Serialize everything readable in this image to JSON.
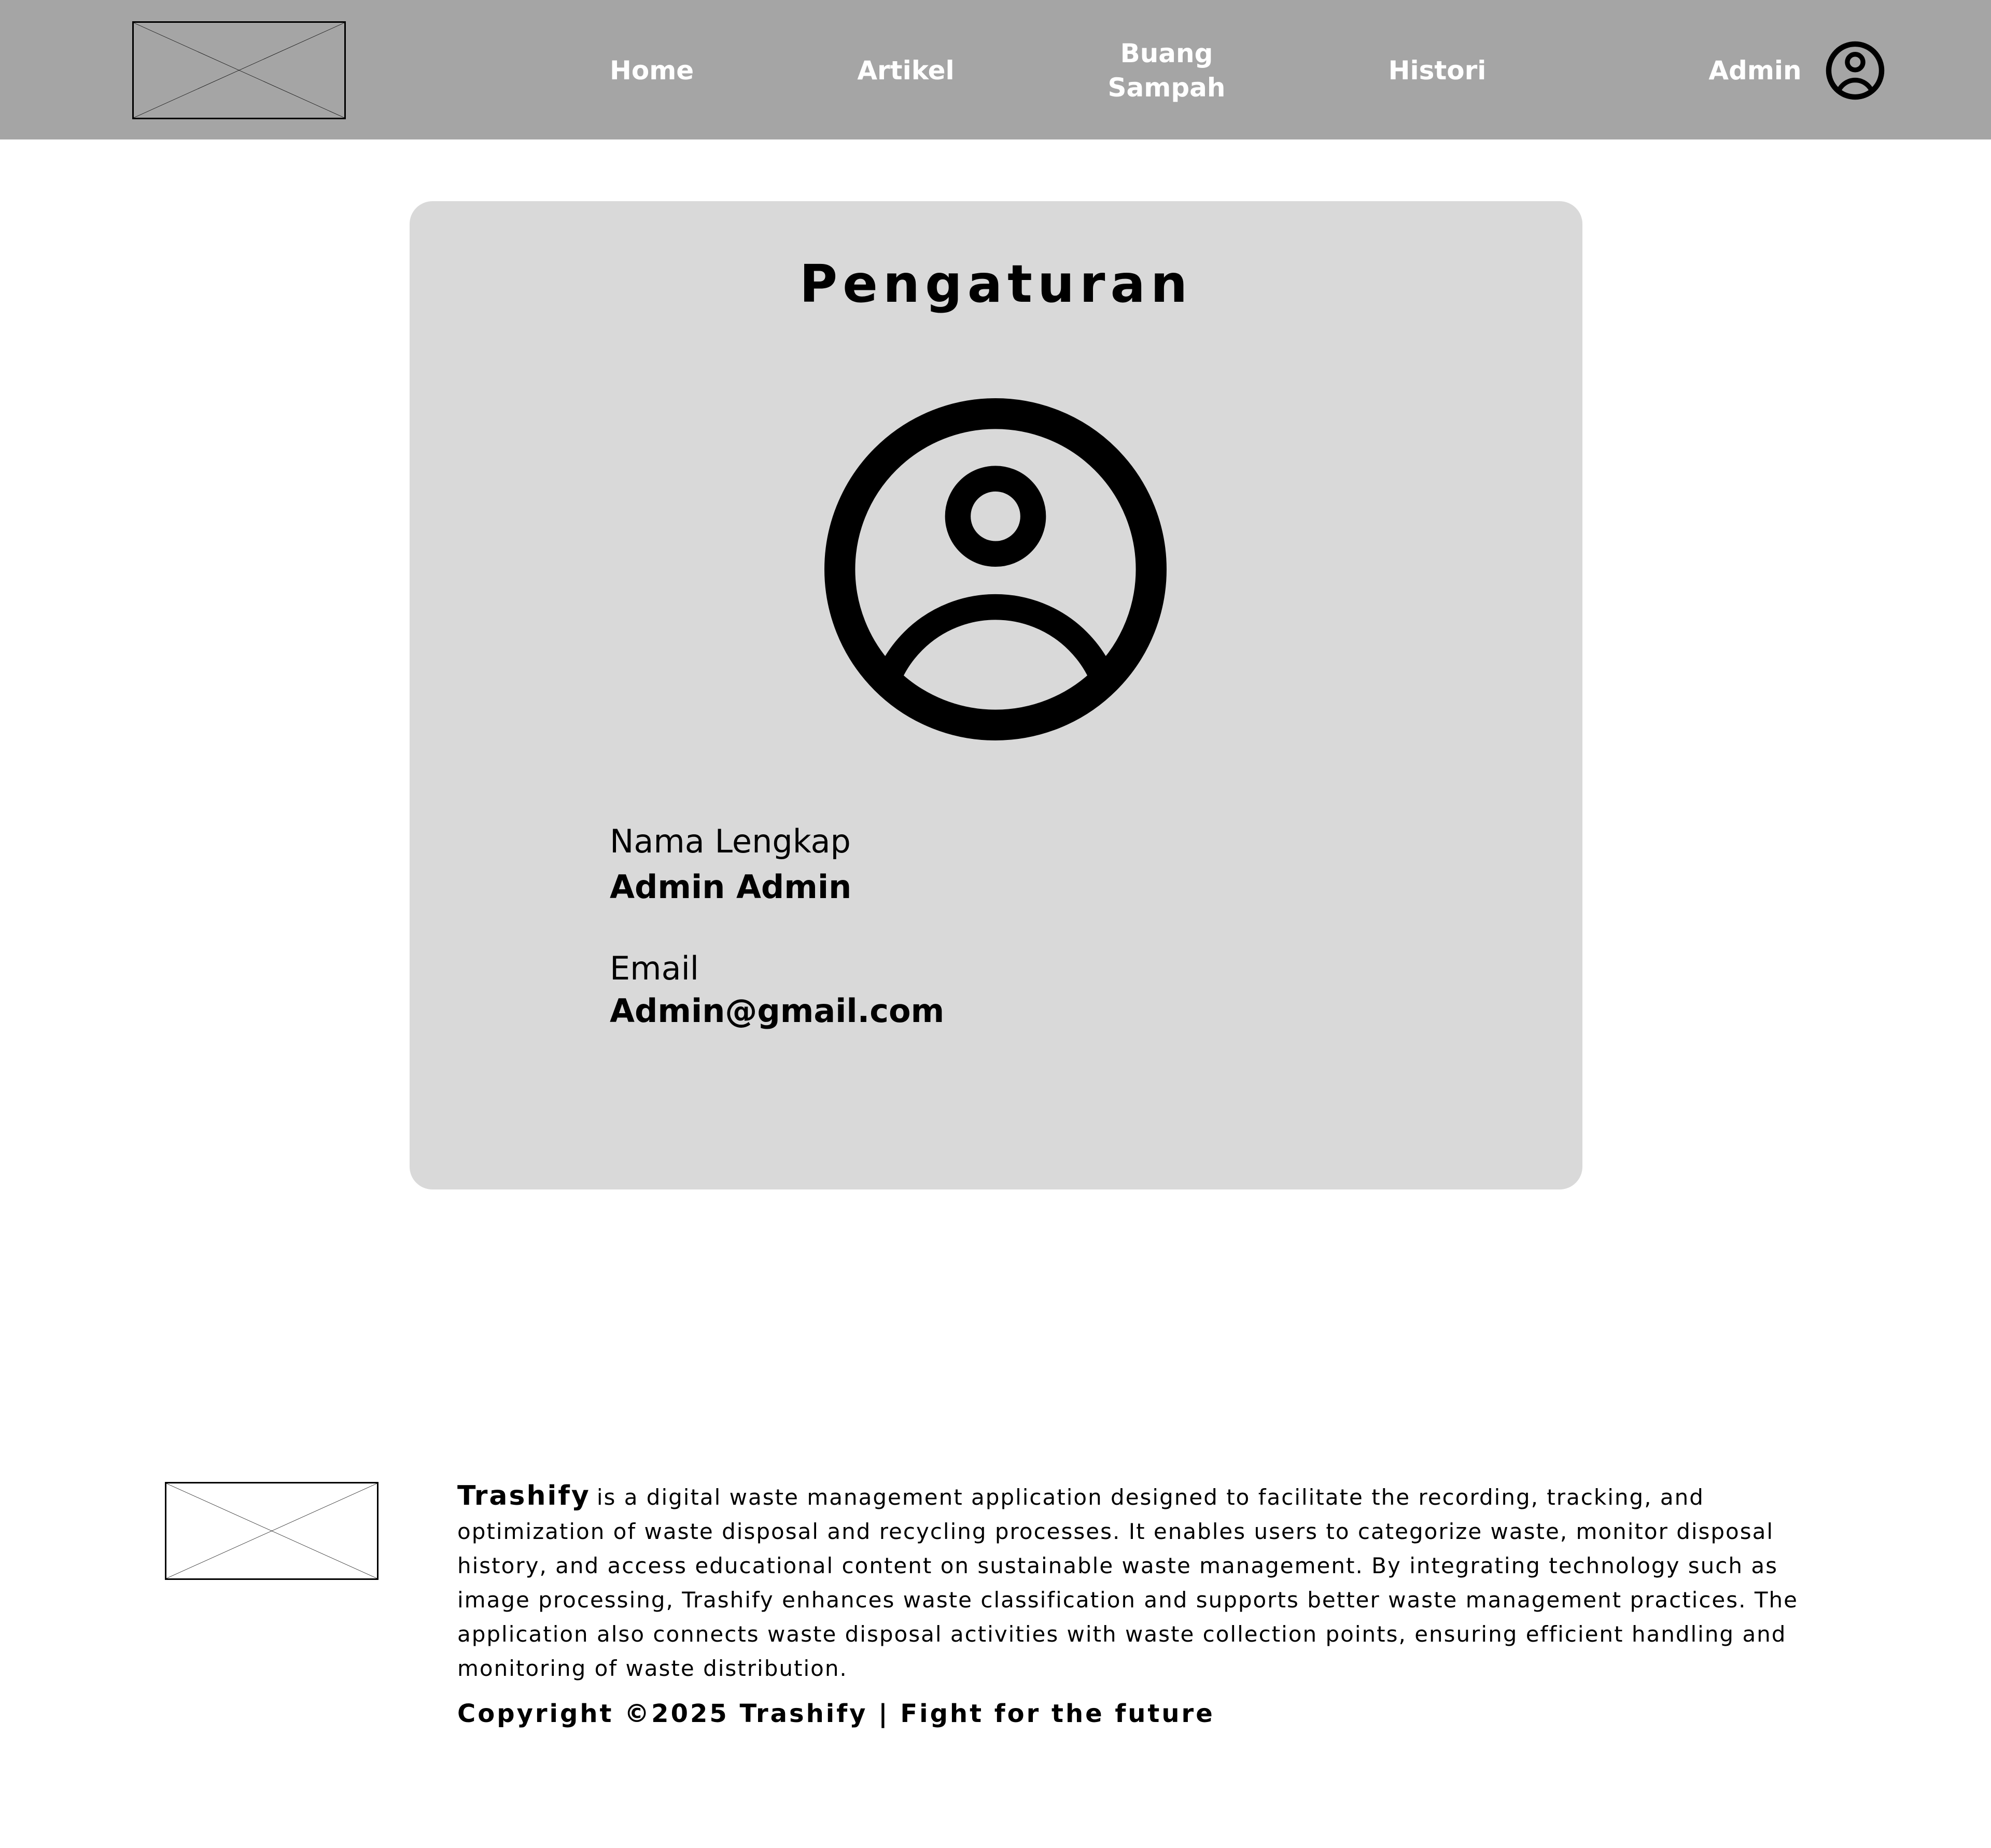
{
  "header": {
    "logo_icon": "image-placeholder-icon",
    "nav": {
      "home": "Home",
      "artikel": "Artikel",
      "buang_line1": "Buang",
      "buang_line2": "Sampah",
      "histori": "Histori",
      "admin": "Admin"
    },
    "avatar_icon": "user-circle-icon",
    "background_color": "#a5a5a5",
    "text_color": "#ffffff"
  },
  "settings_card": {
    "title": "Pengaturan",
    "avatar_icon": "user-circle-icon",
    "full_name_label": "Nama Lengkap",
    "full_name_value": "Admin Admin",
    "email_label": "Email",
    "email_value": "Admin@gmail.com",
    "background_color": "#d9d9d9"
  },
  "footer": {
    "logo_icon": "image-placeholder-icon",
    "brand": "Trashify",
    "description": "is a digital waste management application designed to facilitate the recording, tracking, and optimization of waste disposal and recycling processes. It enables users to categorize waste, monitor disposal history, and access educational content on sustainable waste management. By integrating technology such as image processing, Trashify enhances waste classification and supports better waste management practices. The application also connects waste disposal activities with waste collection points, ensuring efficient handling and monitoring of waste distribution.",
    "copyright": "Copyright ©2025 Trashify | Fight for the future"
  }
}
